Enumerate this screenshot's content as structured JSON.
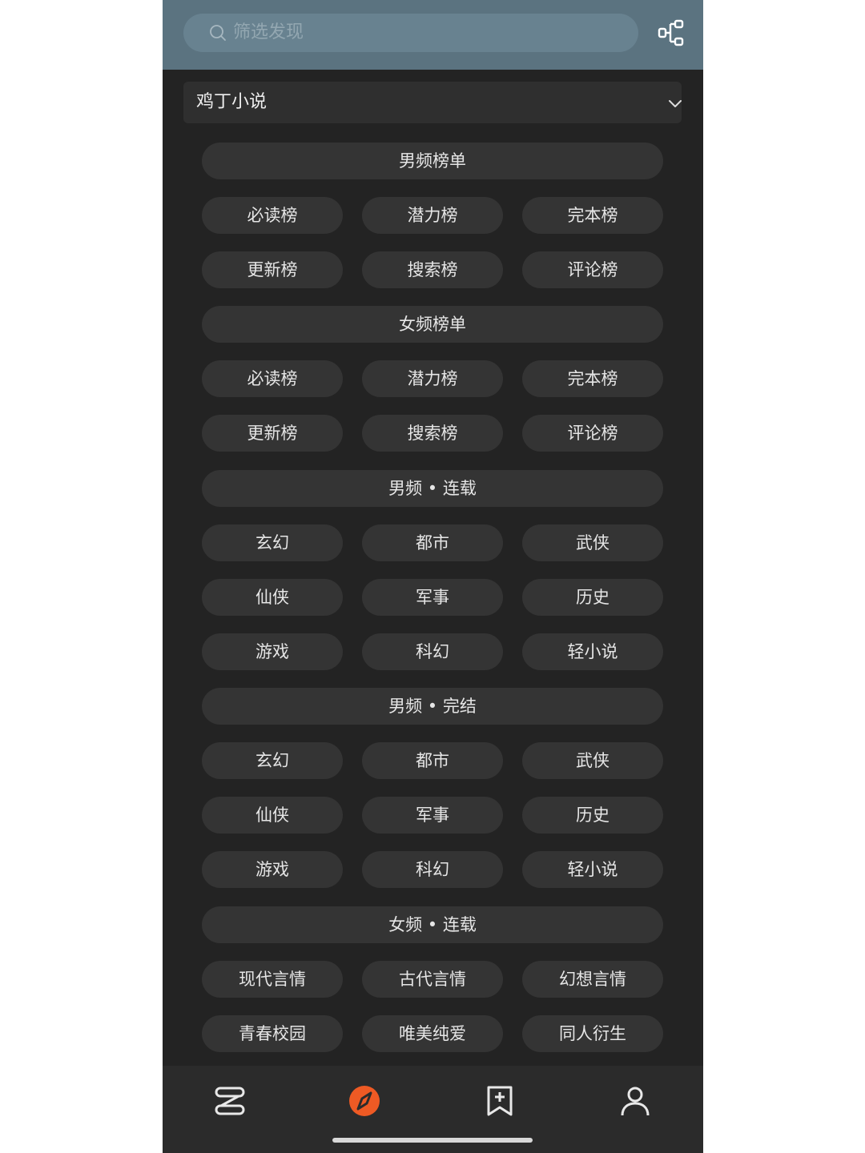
{
  "search": {
    "placeholder": "筛选发现"
  },
  "source": {
    "selected": "鸡丁小说"
  },
  "colors": {
    "accent": "#ee5a24",
    "background": "#232323",
    "topbar": "#5b7380",
    "pill": "#343434"
  },
  "sections": [
    {
      "title": "男频榜单",
      "items": [
        "必读榜",
        "潜力榜",
        "完本榜",
        "更新榜",
        "搜索榜",
        "评论榜"
      ]
    },
    {
      "title": "女频榜单",
      "items": [
        "必读榜",
        "潜力榜",
        "完本榜",
        "更新榜",
        "搜索榜",
        "评论榜"
      ]
    },
    {
      "title": "男频 • 连载",
      "items": [
        "玄幻",
        "都市",
        "武侠",
        "仙侠",
        "军事",
        "历史",
        "游戏",
        "科幻",
        "轻小说"
      ]
    },
    {
      "title": "男频 • 完结",
      "items": [
        "玄幻",
        "都市",
        "武侠",
        "仙侠",
        "军事",
        "历史",
        "游戏",
        "科幻",
        "轻小说"
      ]
    },
    {
      "title": "女频 • 连载",
      "items": [
        "现代言情",
        "古代言情",
        "幻想言情",
        "青春校园",
        "唯美纯爱",
        "同人衍生"
      ]
    }
  ],
  "bottom_nav": {
    "items": [
      {
        "icon": "bookshelf-icon",
        "active": false
      },
      {
        "icon": "compass-icon",
        "active": true
      },
      {
        "icon": "bookmark-add-icon",
        "active": false
      },
      {
        "icon": "profile-icon",
        "active": false
      }
    ]
  }
}
